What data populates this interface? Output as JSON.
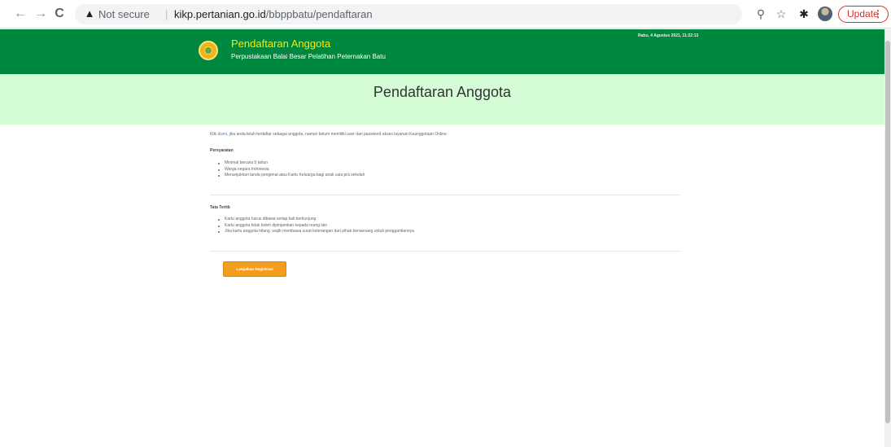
{
  "browser": {
    "back_icon": "←",
    "forward_icon": "→",
    "reload_icon": "C",
    "warning_icon": "▲",
    "security_label": "Not secure",
    "separator": "|",
    "url_host": "kikp.pertanian.go.id",
    "url_path": "/bbppbatu/pendaftaran",
    "zoom_icon": "⚲",
    "bookmark_icon": "☆",
    "extension_icon": "✱",
    "update_label": "Update",
    "menu_icon": "⋮"
  },
  "header": {
    "title": "Pendaftaran Anggota",
    "subtitle": "Perpustakaan Balai Besar Pelatihan Peternakan Batu",
    "datetime": "Rabu, 4 Agustus 2021, 11:22:13"
  },
  "banner": {
    "title": "Pendaftaran Anggota"
  },
  "content": {
    "intro_prefix": "Klik ",
    "intro_link": "disini",
    "intro_suffix": ", jika anda telah terdaftar sebagai anggota, namun belum memiliki user dan password akses layanan Keanggotaan Online.",
    "requirements_title": "Persyaratan",
    "requirements": [
      "Minimal berusia 5 tahun",
      "Warga negara Indonesia",
      "Menunjukkan tanda pengenal atau Kartu Keluarga bagi anak usia pra sekolah"
    ],
    "rules_title": "Tata Tertib",
    "rules": [
      "Kartu anggota harus dibawa setiap kali berkunjung",
      "Kartu anggota tidak boleh dipinjamkan kepada orang lain",
      "Jika kartu anggota hilang, wajib membawa surat keterangan dari pihak berwenang untuk penggantiannya"
    ],
    "continue_button": "Lanjutkan Registrasi"
  },
  "colors": {
    "header_green": "#00873e",
    "title_yellow": "#ffe800",
    "banner_green": "#d5fdd5",
    "button_orange": "#f29d1e",
    "update_red": "#d93025"
  }
}
